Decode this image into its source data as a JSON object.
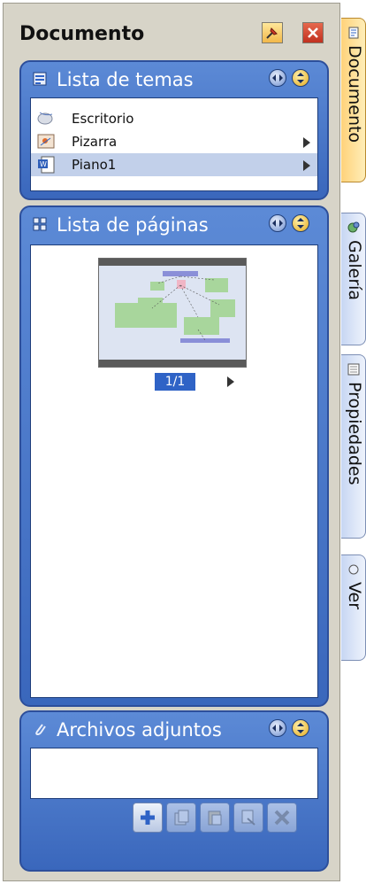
{
  "window": {
    "title": "Documento"
  },
  "panels": {
    "topics": {
      "title": "Lista de temas",
      "items": [
        {
          "label": "Escritorio",
          "icon": "desktop-icon"
        },
        {
          "label": "Pizarra",
          "icon": "whiteboard-icon"
        },
        {
          "label": "Piano1",
          "icon": "word-document-icon"
        }
      ],
      "selected": "Piano1"
    },
    "pages": {
      "title": "Lista de páginas",
      "page_indicator": "1/1"
    },
    "attachments": {
      "title": "Archivos adjuntos",
      "buttons": [
        {
          "icon": "add-icon",
          "enabled": true
        },
        {
          "icon": "copy-icon",
          "enabled": false
        },
        {
          "icon": "paste-icon",
          "enabled": false
        },
        {
          "icon": "cut-icon",
          "enabled": false
        },
        {
          "icon": "delete-icon",
          "enabled": false
        }
      ]
    }
  },
  "side_tabs": [
    {
      "label": "Documento",
      "active": true
    },
    {
      "label": "Galería",
      "active": false
    },
    {
      "label": "Propiedades",
      "active": false
    },
    {
      "label": "Ver",
      "active": false
    }
  ],
  "colors": {
    "panel_blue": "#3a67bc",
    "active_tab": "#ffd27a",
    "selection": "#c2d0ea",
    "page_badge": "#2f63c6"
  }
}
